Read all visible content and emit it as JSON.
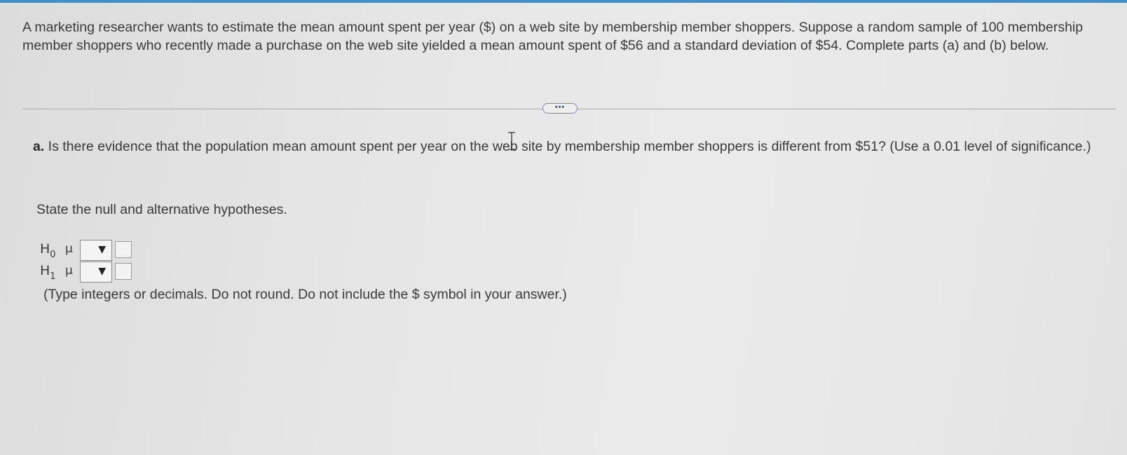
{
  "problem": {
    "text": "A marketing researcher wants to estimate the mean amount spent per year ($) on a web site by membership member shoppers. Suppose a random sample of 100 membership member shoppers who recently made a purchase on the web site yielded a mean amount spent of $56 and a standard deviation of $54. Complete parts (a) and (b) below."
  },
  "expand_button": {
    "label": "•••"
  },
  "part_a": {
    "label": "a.",
    "question": " Is there evidence that the population mean amount spent per year on the web site by membership member shoppers is different from $51? (Use a 0.01 level of significance.)"
  },
  "instruction": "State the null and alternative hypotheses.",
  "hypotheses": [
    {
      "symbol": "H",
      "subscript": "0",
      "param": "μ",
      "operator_value": "",
      "value": ""
    },
    {
      "symbol": "H",
      "subscript": "1",
      "param": "μ",
      "operator_value": "",
      "value": ""
    }
  ],
  "dropdown_arrow": "▼",
  "note": "(Type integers or decimals. Do not round. Do not include the $ symbol in your answer.)",
  "colors": {
    "top_bar": "#3f8fc9",
    "text": "#3a3a3a"
  }
}
